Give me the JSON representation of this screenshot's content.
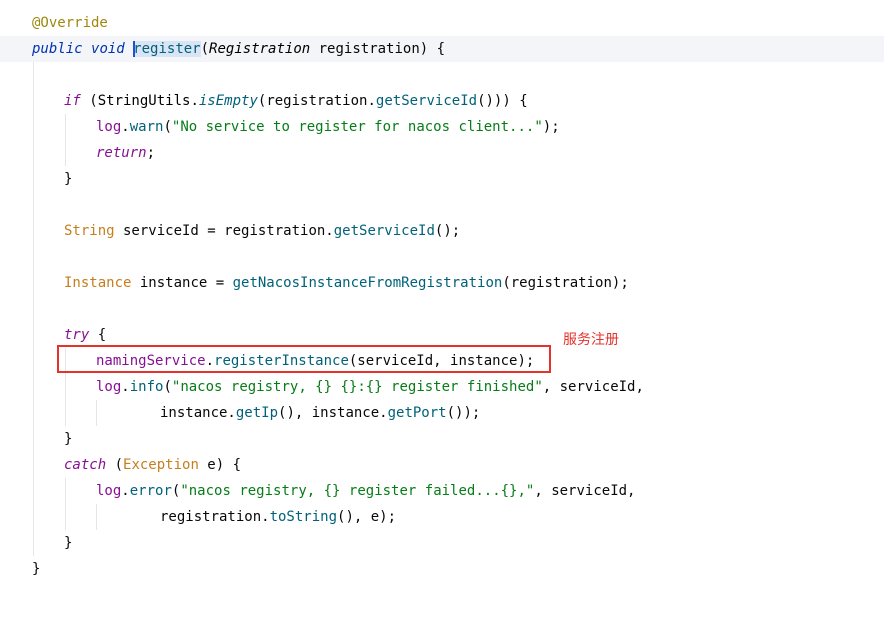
{
  "code": {
    "l1": {
      "annotation": "@Override"
    },
    "l2": {
      "kw_public": "public",
      "kw_void": "void",
      "method_name": "register",
      "open_paren": "(",
      "param_type": "Registration",
      "param_name": " registration) {"
    },
    "l4": {
      "kw_if": "if",
      "open": " (",
      "cls": "StringUtils",
      "dot": ".",
      "method": "isEmpty",
      "mid": "(registration.",
      "method2": "getServiceId",
      "end": "())) {"
    },
    "l5": {
      "field": "log",
      "dot": ".",
      "method": "warn",
      "open": "(",
      "str": "\"No service to register for nacos client...\"",
      "end": ");"
    },
    "l6": {
      "kw": "return",
      "end": ";"
    },
    "l7": {
      "text": "}"
    },
    "l9": {
      "type": "String",
      "rest": " serviceId = registration.",
      "method": "getServiceId",
      "end": "();"
    },
    "l11": {
      "type": "Instance",
      "rest": " instance = ",
      "method": "getNacosInstanceFromRegistration",
      "end": "(registration);"
    },
    "l13": {
      "kw": "try",
      "end": " {"
    },
    "l14": {
      "field": "namingService",
      "dot": ".",
      "method": "registerInstance",
      "end": "(serviceId, instance);"
    },
    "l15": {
      "field": "log",
      "dot": ".",
      "method": "info",
      "open": "(",
      "str": "\"nacos registry, {} {}:{} register finished\"",
      "end": ", serviceId,"
    },
    "l16": {
      "pre": "instance.",
      "method": "getIp",
      "mid": "(), instance.",
      "method2": "getPort",
      "end": "());"
    },
    "l17": {
      "text": "}"
    },
    "l18": {
      "kw": "catch",
      "open": " (",
      "type": "Exception",
      "end": " e) {"
    },
    "l19": {
      "field": "log",
      "dot": ".",
      "method": "error",
      "open": "(",
      "str": "\"nacos registry, {} register failed...{},\"",
      "end": ", serviceId,"
    },
    "l20": {
      "pre": "registration.",
      "method": "toString",
      "end": "(), e);"
    },
    "l21": {
      "text": "}"
    },
    "l22": {
      "text": "}"
    }
  },
  "annotation_note": "服务注册",
  "colors": {
    "highlight_box": "#e5332c",
    "keyword": "#0033b3",
    "method": "#00627a",
    "string": "#067d17",
    "field": "#871094"
  }
}
